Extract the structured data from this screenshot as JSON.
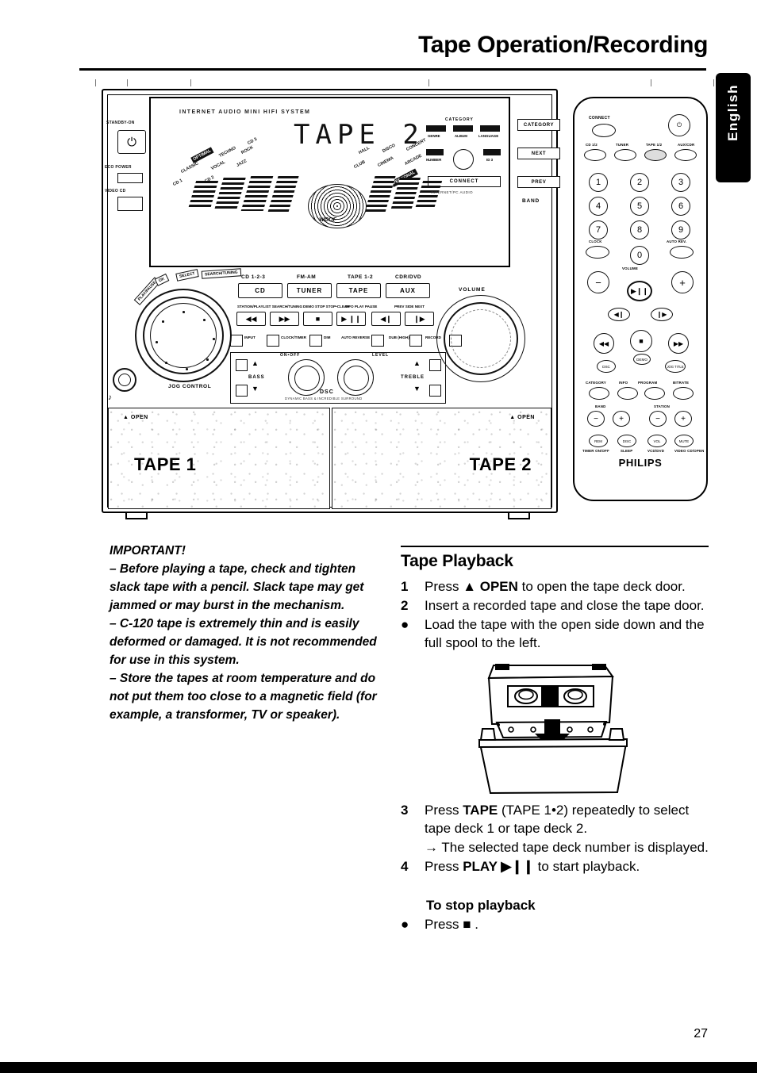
{
  "page": {
    "title": "Tape Operation/Recording",
    "number": "27",
    "language_tab": "English"
  },
  "illustration": {
    "system": {
      "brandline": "INTERNET AUDIO MINI HIFI SYSTEM",
      "lcd_text": "TAPE 2",
      "standby_label": "STANDBY-ON",
      "standby_icon": "power-icon",
      "eco_power_label": "ECO POWER",
      "video_label": "VIDEO CD",
      "eq_presets": [
        "OPTIMAL",
        "TECHNO",
        "ROCK",
        "CLASSIC",
        "VOCAL",
        "JAZZ",
        "CD 1",
        "CD 2",
        "CD 3"
      ],
      "eq_right_presets": [
        "HALL",
        "DISCO",
        "CONCERT",
        "CLUB",
        "CINEMA",
        "ARCADE",
        "PERSONAL"
      ],
      "woofer_label": "WOOF",
      "category": {
        "title": "CATEGORY",
        "chips": [
          "GENRE",
          "ALBUM",
          "LANGUAGE",
          "NUMBER",
          "ID 3"
        ],
        "knob": "category-knob",
        "connect_button": "CONNECT",
        "connect_sub": "INTERNET/PC AUDIO"
      },
      "right_keys": [
        "CATEGORY",
        "NEXT",
        "PREV"
      ],
      "band_label": "BAND",
      "source_captions": [
        "CD 1-2-3",
        "FM-AM",
        "TAPE 1-2",
        "CDR/DVD"
      ],
      "source_buttons": [
        "CD",
        "TUNER",
        "TAPE",
        "AUX"
      ],
      "transport_captions": [
        "STATION/PLAYLIST\nSEARCH/TUNING",
        "DEMO STOP\nSTOP•CLEAR",
        "INFO\nPLAY PAUSE",
        "PREV  SIDE  NEXT"
      ],
      "transport_buttons": [
        "◀◀",
        "▶▶",
        "■",
        "▶ ❙❙",
        "◀❙",
        "❙▶"
      ],
      "feature_buttons": [
        "INPUT",
        "CLOCK/TIMER",
        "DIM",
        "AUTO REVERSE",
        "DUB (HIGH)",
        "RECORD"
      ],
      "bass_label": "BASS",
      "treble_label": "TREBLE",
      "dsc_on_off": "ON•OFF",
      "dsc_level": "LEVEL",
      "dsc_label": "DSC",
      "dsc_sub": "DYNAMIC BASS & INCREDIBLE SURROUND",
      "volume_label": "VOLUME",
      "jog_label": "JOG CONTROL",
      "jog_tabs": [
        "PLAY/PAUSE",
        "OK",
        "SELECT",
        "SEARCH/TUNING"
      ],
      "headphone_icon": "headphone-icon",
      "decks": [
        {
          "name": "TAPE 1",
          "open_label": "▲ OPEN"
        },
        {
          "name": "TAPE 2",
          "open_label": "▲ OPEN"
        }
      ]
    },
    "remote": {
      "connect_label": "CONNECT",
      "power_icon": "power-icon",
      "source_captions": [
        "CD 1/2",
        "TUNER",
        "TAPE 1/2",
        "AUX/CDR"
      ],
      "numbers": [
        "1",
        "2",
        "3",
        "4",
        "5",
        "6",
        "7",
        "8",
        "9",
        "0"
      ],
      "clock_label": "CLOCK",
      "autorev_label": "AUTO REV.",
      "volume_label": "VOLUME",
      "volume_down": "−",
      "volume_up": "+",
      "play_pause": "▶❙❙",
      "prev": "◀❙",
      "next": "❙▶",
      "rewind": "◀◀",
      "stop": "■",
      "forward": "▶▶",
      "dsc_label": "DSC",
      "demo_label": "DEMO",
      "jog_label": "JOG TITLE",
      "row_labels_1": [
        "CATEGORY",
        "INFO",
        "PROGRAM",
        "BITRATE"
      ],
      "band_label": "BAND",
      "station_label": "STATION",
      "minus": "−",
      "plus": "+",
      "round_labels": [
        "REM",
        "DISC",
        "VOL",
        "MUTE"
      ],
      "bottom_labels": [
        "TIMER ON/OFF",
        "SLEEP",
        "VCD/DVD",
        "VIDEO CD/OPEN"
      ],
      "brand": "PHILIPS"
    }
  },
  "important": {
    "title": "IMPORTANT!",
    "paragraphs": [
      "–  Before playing a tape, check and tighten slack tape with a pencil. Slack tape may get jammed or may burst in the mechanism.",
      "–  C-120 tape is extremely thin and is easily deformed or damaged.  It is not recommended for use in this system.",
      "–  Store the tapes at room temperature and do not put them too close to a magnetic field (for example, a transformer, TV or speaker)."
    ]
  },
  "playback": {
    "title": "Tape Playback",
    "steps": [
      {
        "marker": "1",
        "type": "number",
        "text_parts": [
          {
            "t": "Press ",
            "b": false
          },
          {
            "t": "▲ OPEN",
            "b": true
          },
          {
            "t": " to open the tape deck door.",
            "b": false
          }
        ]
      },
      {
        "marker": "2",
        "type": "number",
        "text_parts": [
          {
            "t": "Insert a recorded tape and close the tape door.",
            "b": false
          }
        ]
      },
      {
        "marker": "●",
        "type": "bullet",
        "text_parts": [
          {
            "t": "Load the tape with the open side down and the full spool to the left.",
            "b": false
          }
        ]
      }
    ],
    "steps_lower": [
      {
        "marker": "3",
        "type": "number",
        "text_parts": [
          {
            "t": "Press ",
            "b": false
          },
          {
            "t": "TAPE",
            "b": true
          },
          {
            "t": " (TAPE 1•2) repeatedly to select tape deck 1 or tape deck 2.",
            "b": false
          }
        ]
      },
      {
        "marker": "",
        "type": "arrow",
        "text_parts": [
          {
            "t": "→ The selected tape deck number is displayed.",
            "b": false
          }
        ]
      },
      {
        "marker": "4",
        "type": "number",
        "text_parts": [
          {
            "t": "Press ",
            "b": false
          },
          {
            "t": "PLAY ▶❙❙",
            "b": true
          },
          {
            "t": " to start playback.",
            "b": false
          }
        ]
      }
    ],
    "stop_title": "To stop playback",
    "stop_step": {
      "marker": "●",
      "text_parts": [
        {
          "t": "Press ",
          "b": false
        },
        {
          "t": "■",
          "b": true
        },
        {
          "t": " .",
          "b": false
        }
      ]
    }
  },
  "colors": {
    "ink": "#000000",
    "paper": "#ffffff",
    "tab_bg": "#000000",
    "tab_text": "#ffffff"
  }
}
